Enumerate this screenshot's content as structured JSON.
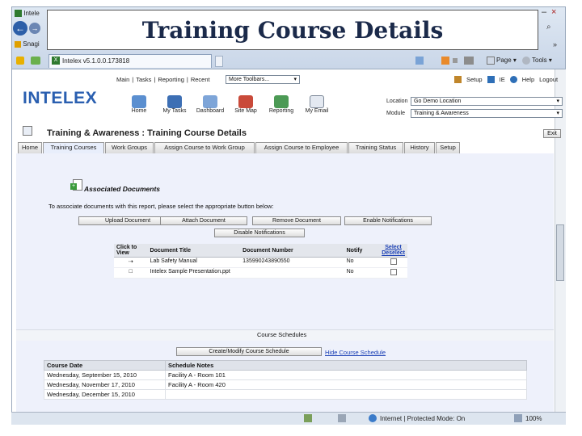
{
  "slide": {
    "title": "Training Course Details"
  },
  "browser": {
    "window_title_fragment": "Intele",
    "minimize": "–",
    "close": "×",
    "favorites_label": "Snagi",
    "search_glyph": "⌕",
    "chevron": "»",
    "tab_title": "Intelex v5.1.0.0.173818",
    "toolbar_items": [
      "Page ▾",
      "Tools ▾"
    ],
    "status": {
      "zone": "Internet | Protected Mode: On",
      "zoom": "100%"
    }
  },
  "app": {
    "logo": "INTELEX",
    "top_menu": [
      "Main",
      "Tasks",
      "Reporting",
      "Recent"
    ],
    "toolbar_select": "More Toolbars...",
    "right_links": [
      "Setup",
      "IE",
      "Help",
      "Logout"
    ],
    "location_label": "Location",
    "location_value": "Go Demo Location",
    "module_label": "Module",
    "module_value": "Training & Awareness",
    "nav_icons": [
      "Home",
      "My Tasks",
      "Dashboard",
      "Site Map",
      "Reporting",
      "My Email"
    ],
    "page_heading": "Training & Awareness :  Training Course Details",
    "exit_label": "Exit",
    "tabs": [
      "Home",
      "Training Courses",
      "Work Groups",
      "Assign Course to Work Group",
      "Assign Course to Employee",
      "Training Status",
      "History",
      "Setup"
    ],
    "associated_documents": {
      "title": "Associated Documents",
      "instructions": "To associate documents with this report, please select the appropriate button below:",
      "buttons": [
        "Upload Document",
        "Attach Document",
        "Remove Document",
        "Enable Notifications"
      ],
      "disable_button": "Disable Notifications",
      "columns": [
        "Click to View",
        "Document Title",
        "Document Number",
        "Notify",
        "Select Deselect"
      ],
      "rows": [
        {
          "title": "Lab Safety Manual",
          "number": "135990243890550",
          "notify": "No"
        },
        {
          "title": "Intelex Sample Presentation.ppt",
          "number": "",
          "notify": "No"
        }
      ]
    },
    "course_schedules": {
      "title": "Course Schedules",
      "create_button": "Create/Modify Course Schedule",
      "hide_link": "Hide Course Schedule",
      "columns": [
        "Course Date",
        "Schedule Notes"
      ],
      "rows": [
        {
          "date": "Wednesday, September 15, 2010",
          "notes": "Facility A - Room 101"
        },
        {
          "date": "Wednesday, November 17, 2010",
          "notes": "Facility A - Room 420"
        },
        {
          "date": "Wednesday, December 15, 2010",
          "notes": ""
        }
      ]
    }
  }
}
